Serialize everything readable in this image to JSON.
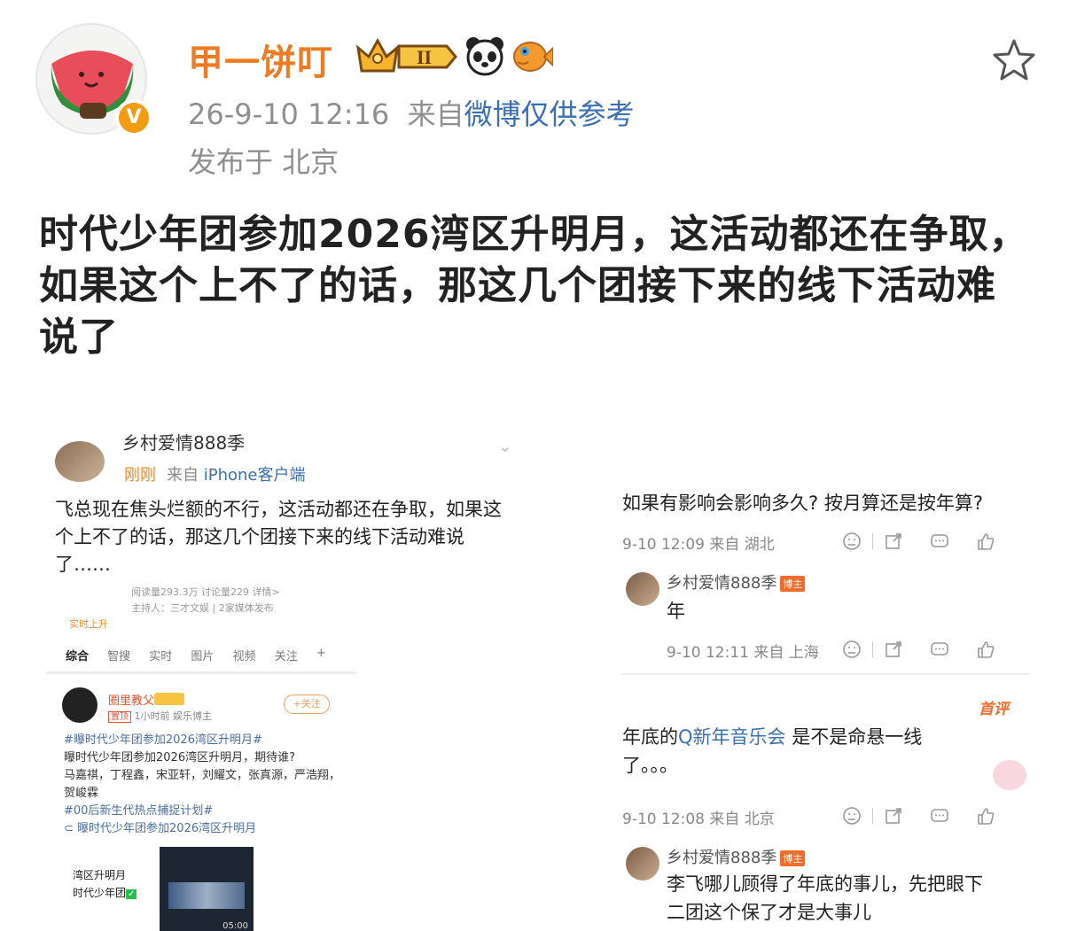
{
  "post": {
    "username": "甲一饼叮",
    "level_badge": "II",
    "time": "26-9-10 12:16",
    "source_prefix": "来自",
    "source": "微博仅供参考",
    "location": "发布于 北京",
    "text": "时代少年团参加2026湾区升明月，这活动都还在争取，如果这个上不了的话，那这几个团接下来的线下活动难说了",
    "verified_badge": "V",
    "icons": [
      "crown-icon",
      "panda-icon",
      "fish-icon",
      "star-icon"
    ]
  },
  "left_shot": {
    "name": "乡村爱情888季",
    "time": "刚刚",
    "source_prefix": "来自",
    "source": "iPhone客户端",
    "text": "飞总现在焦头烂额的不行，这活动都还在争取，如果这个上不了的话，那这几个团接下来的线下活动难说了……",
    "stats_line1": "阅读量293.3万  讨论量229  详情>",
    "stats_line2": "主持人：三才文娱 | 2家媒体发布",
    "hot_label": "实时上升",
    "tabs": [
      "综合",
      "智搜",
      "实时",
      "图片",
      "视频",
      "关注",
      "+"
    ],
    "card": {
      "name": "圈里教父",
      "tag": "置顶",
      "sub": "1小时前  娱乐博主",
      "follow": "+关注",
      "hashtag1": "#曝时代少年团参加2026湾区升明月#",
      "line1": "曝时代少年团参加2026湾区升明月，期待谁?",
      "line2": "马嘉祺，丁程鑫，宋亚轩，刘耀文，张真源，严浩翔，贺峻霖",
      "hashtag2": "#00后新生代热点捕捉计划#",
      "link": "曝时代少年团参加2026湾区升明月",
      "video_label1": "湾区升明月",
      "video_label2": "时代少年团",
      "video_time": "05:00"
    }
  },
  "right_shot": {
    "c1_text": "如果有影响会影响多久? 按月算还是按年算?",
    "c1_meta": "9-10 12:09 来自 湖北",
    "r1_name": "乡村爱情888季",
    "r1_badge": "博主",
    "r1_text": "年",
    "r1_meta": "9-10 12:11 来自 上海",
    "shouping": "首评",
    "c2_text_a": "年底的",
    "c2_keyword": "新年音乐会",
    "c2_text_b": "是不是命悬一线",
    "c2_text_c": "了。。。",
    "c2_meta": "9-10 12:08 来自 北京",
    "r2_name": "乡村爱情888季",
    "r2_badge": "博主",
    "r2_text_1": "李飞哪儿顾得了年底的事儿，先把眼下",
    "r2_text_2": "二团这个保了才是大事儿"
  }
}
